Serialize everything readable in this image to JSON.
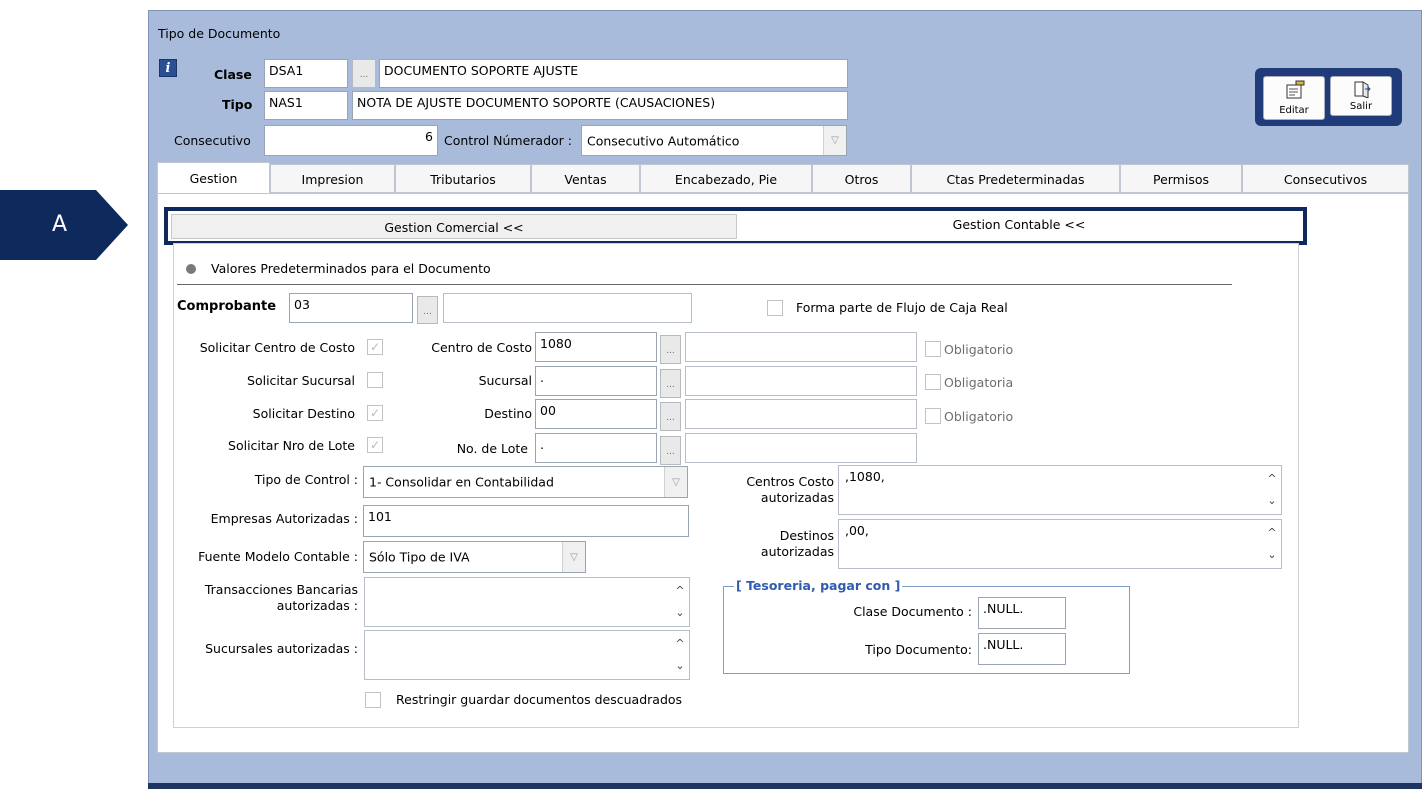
{
  "window": {
    "title": "Tipo de Documento"
  },
  "header": {
    "info_icon": "info-icon",
    "clase_label": "Clase",
    "clase_code": "DSA1",
    "clase_desc": "DOCUMENTO SOPORTE AJUSTE",
    "tipo_label": "Tipo",
    "tipo_code": "NAS1",
    "tipo_desc": "NOTA DE AJUSTE DOCUMENTO SOPORTE (CAUSACIONES)",
    "consecutivo_label": "Consecutivo",
    "consecutivo_value": "6",
    "control_label": "Control Númerador :",
    "control_value": "Consecutivo Automático",
    "ellipsis": "..."
  },
  "toolbar": {
    "editar_label": "Editar",
    "salir_label": "Salir",
    "editar_icon": "edit-icon",
    "salir_icon": "exit-icon"
  },
  "tabs": [
    "Gestion",
    "Impresion",
    "Tributarios",
    "Ventas",
    "Encabezado, Pie",
    "Otros",
    "Ctas Predeterminadas",
    "Permisos",
    "Consecutivos"
  ],
  "subtabs": {
    "comercial": "Gestion Comercial <<",
    "contable": "Gestion Contable <<"
  },
  "annotation": {
    "label": "A",
    "color": "#0e2a5c"
  },
  "gestion": {
    "section_title": "Valores Predeterminados para el Documento",
    "comprobante_label": "Comprobante",
    "comprobante_value": "03",
    "comprobante_desc": "",
    "flujo_label": "Forma parte de Flujo de Caja  Real",
    "rows": [
      {
        "sol_label": "Solicitar Centro de Costo",
        "sol_checked": true,
        "field_label": "Centro de Costo",
        "code": "1080",
        "desc": "",
        "oblig_label": "Obligatorio"
      },
      {
        "sol_label": "Solicitar Sucursal",
        "sol_checked": false,
        "field_label": "Sucursal",
        "code": ".",
        "desc": "",
        "oblig_label": "Obligatoria"
      },
      {
        "sol_label": "Solicitar Destino",
        "sol_checked": true,
        "field_label": "Destino",
        "code": "00",
        "desc": "",
        "oblig_label": "Obligatorio"
      },
      {
        "sol_label": "Solicitar Nro de  Lote",
        "sol_checked": true,
        "field_label": "No. de Lote",
        "code": ".",
        "desc": ""
      }
    ],
    "tipo_control_label": "Tipo de Control :",
    "tipo_control_value": "1- Consolidar en Contabilidad",
    "empresas_label": "Empresas Autorizadas :",
    "empresas_value": "101",
    "fuente_label": "Fuente Modelo Contable :",
    "fuente_value": "Sólo Tipo de IVA",
    "transacciones_label_1": "Transacciones Bancarias",
    "transacciones_label_2": "autorizadas :",
    "transacciones_value": "",
    "sucursales_label": "Sucursales autorizadas :",
    "sucursales_value": "",
    "restringir_label": "Restringir guardar documentos descuadrados",
    "centros_label_1": "Centros Costo",
    "centros_label_2": "autorizadas",
    "centros_value": ",1080,",
    "destinos_label_1": "Destinos",
    "destinos_label_2": "autorizadas",
    "destinos_value": ",00,",
    "tesoreria_title": "[ Tesoreria, pagar con ]",
    "clase_doc_label": "Clase Documento :",
    "clase_doc_value": ".NULL.",
    "tipo_doc_label": "Tipo Documento:",
    "tipo_doc_value": ".NULL."
  }
}
